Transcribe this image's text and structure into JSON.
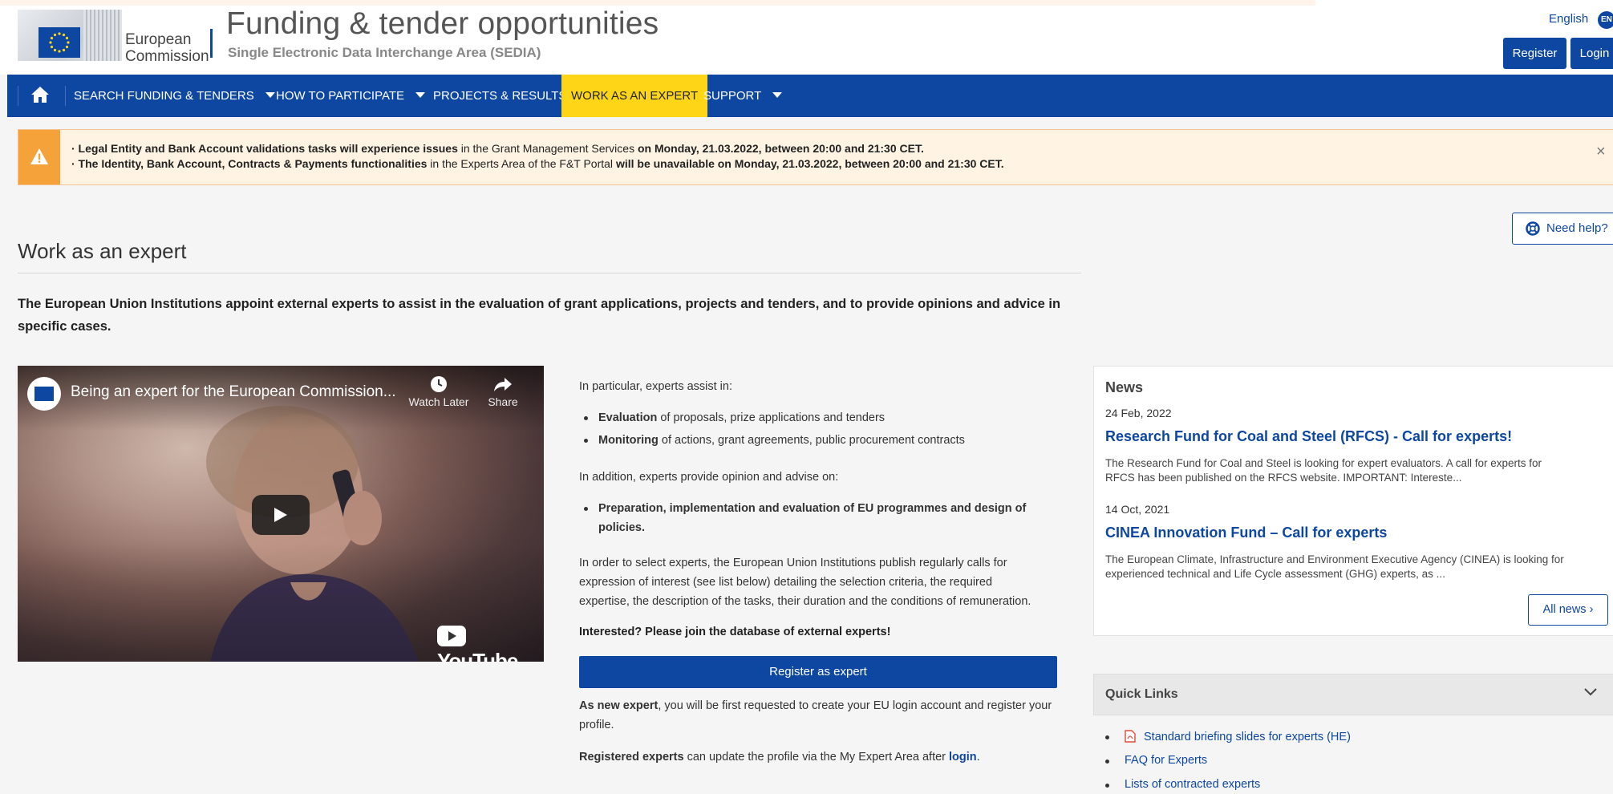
{
  "header": {
    "org_name_line1": "European",
    "org_name_line2": "Commission",
    "portal_title": "Funding & tender opportunities",
    "portal_subtitle": "Single Electronic Data Interchange Area (SEDIA)",
    "language": "English",
    "language_code": "EN",
    "register_label": "Register",
    "login_label": "Login"
  },
  "nav": {
    "home_icon": "home-icon",
    "items": [
      {
        "label": "SEARCH FUNDING & TENDERS",
        "dropdown": true
      },
      {
        "label": "HOW TO PARTICIPATE",
        "dropdown": true
      },
      {
        "label": "PROJECTS & RESULTS",
        "dropdown": false
      },
      {
        "label": "WORK AS AN EXPERT",
        "dropdown": false,
        "active": true
      },
      {
        "label": "SUPPORT",
        "dropdown": true
      }
    ]
  },
  "alert": {
    "icon": "warning-icon",
    "line1": {
      "bold1": "· Legal Entity and Bank Account validations tasks will experience issues",
      "normal1": " in the Grant Management Services ",
      "bold2": "on Monday, 21.03.2022, between 20:00 and 21:30 CET."
    },
    "line2": {
      "bold1": "· The Identity, Bank Account, Contracts & Payments functionalities",
      "normal1": " in the Experts Area of the F&T Portal ",
      "bold2": "will be unavailable on Monday, 21.03.2022, between 20:00 and 21:30 CET."
    },
    "close_icon": "×"
  },
  "need_help_label": "Need help?",
  "page": {
    "title": "Work as an expert",
    "intro": "The European Union Institutions appoint external experts to assist in the evaluation of grant applications, projects and tenders, and to provide opinions and advice in specific cases."
  },
  "video": {
    "title": "Being an expert for the European Commission...",
    "watch_later": "Watch Later",
    "share": "Share",
    "platform": "YouTube"
  },
  "middle": {
    "p1": "In particular, experts assist in:",
    "li1_bold": "Evaluation",
    "li1_rest": " of proposals, prize applications and tenders",
    "li2_bold": "Monitoring",
    "li2_rest": " of actions, grant agreements, public procurement contracts",
    "p2": "In addition, experts provide opinion and advise on:",
    "li3_line1": "Preparation, implementation and evaluation of EU programmes and design of",
    "li3_line2": "policies.",
    "p3_line1": "In order to select experts, the European Union Institutions publish regularly calls for",
    "p3_line2": "expression of interest (see list below) detailing the selection criteria, the required",
    "p3_line3": "expertise, the description of the tasks, their duration and the conditions of remuneration.",
    "interested": "Interested? Please join the database of external experts!",
    "register_button": "Register as expert",
    "new_expert_bold": "As new expert",
    "new_expert_rest": ", you will be first requested to create your EU login account and register your",
    "new_expert_line2": "profile.",
    "registered_bold": "Registered experts",
    "registered_rest": " can update the profile via the My Expert Area after ",
    "login_link": "login",
    "registered_end": "."
  },
  "news": {
    "heading": "News",
    "items": [
      {
        "date": "24 Feb, 2022",
        "title": "Research Fund for Coal and Steel (RFCS) - Call for experts!",
        "excerpt_line1": "The Research Fund for Coal and Steel is looking for expert evaluators. A call for experts for",
        "excerpt_line2": "RFCS has been published on the RFCS website. IMPORTANT: Intereste..."
      },
      {
        "date": "14 Oct, 2021",
        "title": "CINEA Innovation Fund – Call for experts",
        "excerpt_line1": "The European Climate, Infrastructure and Environment Executive Agency (CINEA) is looking for",
        "excerpt_line2": "experienced technical and Life Cycle assessment (GHG) experts, as ..."
      }
    ],
    "all_news_label": "All news ›"
  },
  "quick_links": {
    "title": "Quick Links",
    "items": [
      {
        "label": "Standard briefing slides for experts (HE)",
        "icon": "pdf-icon"
      },
      {
        "label": "FAQ for Experts"
      },
      {
        "label": "Lists of contracted experts"
      }
    ]
  },
  "colors": {
    "brand_blue": "#0e47a1",
    "active_nav": "#ffd617",
    "alert_orange": "#f5a23b"
  }
}
